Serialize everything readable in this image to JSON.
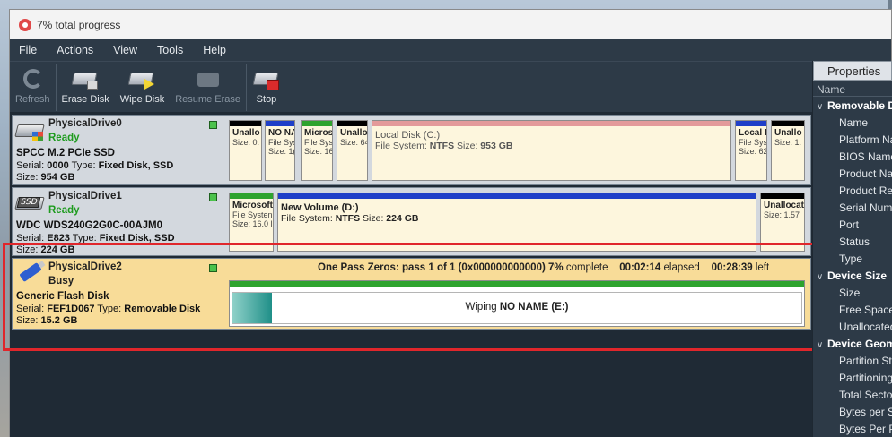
{
  "window": {
    "title": "7% total progress"
  },
  "menu": [
    "File",
    "Actions",
    "View",
    "Tools",
    "Help"
  ],
  "toolbar": {
    "refresh": "Refresh",
    "erase_disk": "Erase Disk",
    "wipe_disk": "Wipe Disk",
    "resume_erase": "Resume Erase",
    "stop": "Stop"
  },
  "drives": [
    {
      "name": "PhysicalDrive0",
      "state": "Ready",
      "model": "SPCC M.2 PCIe SSD",
      "serial_label": "Serial: ",
      "serial": "0000",
      "type_label": " Type: ",
      "type": "Fixed Disk, SSD",
      "size_label": "Size: ",
      "size": "954 GB",
      "partitions": [
        {
          "name": "Unallo",
          "info": "Size: 0.",
          "color": "#000000"
        },
        {
          "name": "NO NA",
          "info": "File Sys\nSize: 10",
          "color": "#1f3fc8"
        },
        {
          "name": "Micros",
          "info": "File Sys\nSize: 16",
          "color": "#2ea32e"
        },
        {
          "name": "Unallo",
          "info": "Size: 64",
          "color": "#000000"
        },
        {
          "name": "Local Disk (C:)",
          "info_prefix": "File System: ",
          "fs": "NTFS",
          "size_prefix": " Size: ",
          "size": "953 GB",
          "color": "#e39a9a"
        },
        {
          "name": "Local D",
          "info": "File Sys\nSize: 62",
          "color": "#1f3fc8"
        },
        {
          "name": "Unallo",
          "info": "Size: 1.",
          "color": "#000000"
        }
      ]
    },
    {
      "name": "PhysicalDrive1",
      "state": "Ready",
      "model": "WDC WDS240G2G0C-00AJM0",
      "serial_label": "Serial: ",
      "serial": "E823",
      "type_label": " Type: ",
      "type": "Fixed Disk, SSD",
      "size_label": "Size: ",
      "size": "224 GB",
      "partitions": [
        {
          "name": "Microsoft",
          "info": "File Systen\nSize: 16.0 l",
          "color": "#2ea32e"
        },
        {
          "name": "New Volume (D:)",
          "info_prefix": "File System: ",
          "fs": "NTFS",
          "size_prefix": " Size: ",
          "size": "224 GB",
          "color": "#1f3fc8"
        },
        {
          "name": "Unallocat",
          "info": "Size: 1.57",
          "color": "#000000"
        }
      ]
    },
    {
      "name": "PhysicalDrive2",
      "state": "Busy",
      "model": "Generic Flash Disk",
      "serial_label": "Serial: ",
      "serial": "FEF1D067",
      "type_label": " Type: ",
      "type": "Removable Disk",
      "size_label": "Size: ",
      "size": "15.2 GB",
      "progress": {
        "prefix": "One Pass Zeros: pass 1 of 1 (0x000000000000) ",
        "percent": "7%",
        "complete": " complete",
        "elapsed": "00:02:14",
        "elapsed_label": " elapsed",
        "left": "00:28:39",
        "left_label": " left",
        "fraction": 0.07
      },
      "wipe_label_prefix": "Wiping ",
      "wipe_target": "NO NAME (E:)"
    }
  ],
  "properties": {
    "title": "Properties",
    "header": "Name",
    "groups": [
      {
        "name": "Removable Disk",
        "items": [
          "Name",
          "Platform Name",
          "BIOS Name",
          "Product Name",
          "Product Revision",
          "Serial Number",
          "Port",
          "Status",
          "Type"
        ]
      },
      {
        "name": "Device Size",
        "items": [
          "Size",
          "Free Space",
          "Unallocated"
        ]
      },
      {
        "name": "Device Geometry",
        "items": [
          "Partition Style",
          "Partitioning",
          "Total Sectors",
          "Bytes per Sector",
          "Bytes Per Physical"
        ]
      }
    ]
  },
  "colors": {
    "ready": "#1e9b1e",
    "busy_row": "#f8dc98",
    "highlight": "#e0262b",
    "progress_green": "#2ea32e"
  }
}
